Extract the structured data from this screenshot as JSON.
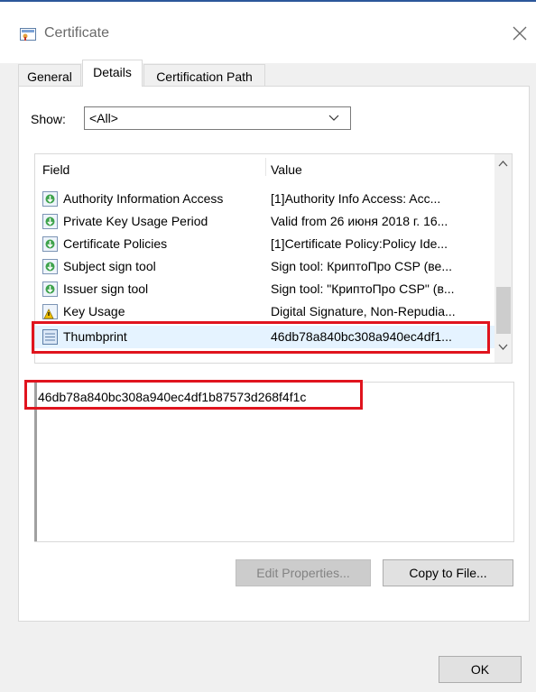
{
  "window": {
    "title": "Certificate"
  },
  "tabs": [
    "General",
    "Details",
    "Certification Path"
  ],
  "show": {
    "label": "Show:",
    "value": "<All>"
  },
  "list": {
    "headers": {
      "field": "Field",
      "value": "Value"
    },
    "rows": [
      {
        "field": "Authority Information Access",
        "value": "[1]Authority Info Access: Acc...",
        "icon": "cert-field-icon"
      },
      {
        "field": "Private Key Usage Period",
        "value": "Valid from 26 июня 2018 г. 16...",
        "icon": "cert-field-icon"
      },
      {
        "field": "Certificate Policies",
        "value": "[1]Certificate Policy:Policy Ide...",
        "icon": "cert-field-icon"
      },
      {
        "field": "Subject sign tool",
        "value": "Sign tool: КриптоПро CSP (ве...",
        "icon": "cert-field-icon"
      },
      {
        "field": "Issuer sign tool",
        "value": "Sign tool: \"КриптоПро CSP\" (в...",
        "icon": "cert-field-icon"
      },
      {
        "field": "Key Usage",
        "value": "Digital Signature, Non-Repudia...",
        "icon": "warning-icon"
      },
      {
        "field": "Thumbprint",
        "value": "46db78a840bc308a940ec4df1...",
        "icon": "thumbprint-icon"
      }
    ]
  },
  "detail": {
    "value": "46db78a840bc308a940ec4df1b87573d268f4f1c"
  },
  "buttons": {
    "edit": "Edit Properties...",
    "copy": "Copy to File...",
    "ok": "OK"
  },
  "colors": {
    "highlight": "#e0141e",
    "selection": "#e5f3ff",
    "accent": "#2b579a"
  }
}
